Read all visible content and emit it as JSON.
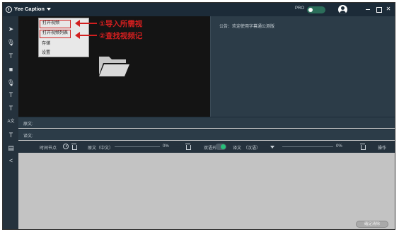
{
  "app": {
    "title": "Yee Caption"
  },
  "header": {
    "pro_label": "PRO"
  },
  "window_controls": {
    "close": "✕"
  },
  "toolbar_tools": [
    {
      "name": "pointer-icon",
      "glyph": "➤"
    },
    {
      "name": "microphone-icon",
      "glyph": "🎙"
    },
    {
      "name": "text-icon",
      "glyph": "T"
    },
    {
      "name": "rectangle-icon",
      "glyph": "■"
    },
    {
      "name": "mic-settings-icon",
      "glyph": "🎙"
    },
    {
      "name": "text-box-icon",
      "glyph": "T"
    },
    {
      "name": "text-style-icon",
      "glyph": "T"
    },
    {
      "name": "translate-icon",
      "glyph": "A文"
    },
    {
      "name": "subtitle-icon",
      "glyph": "T"
    },
    {
      "name": "film-icon",
      "glyph": "▤"
    },
    {
      "name": "share-icon",
      "glyph": "<"
    }
  ],
  "menu": {
    "items": [
      "打开视频",
      "打开视频列表",
      "存储",
      "设置"
    ]
  },
  "annotations": {
    "first": "①导入所需视",
    "second": "②查找视频记"
  },
  "notice": {
    "text": "公告：欢迎使用字幕通公测版"
  },
  "subtitles": {
    "original_label": "原文:",
    "translation_label": "译文:"
  },
  "controls": {
    "time_nodes_label": "时间节点",
    "original_lang_label": "原文（中文）",
    "original_progress": "0%",
    "bilingual_label": "双语开关",
    "translation_label": "译文",
    "translation_lang": "（汉语）",
    "translation_progress": "0%",
    "operation_label": "操作"
  },
  "bottom": {
    "button_label": "確定清除"
  },
  "colors": {
    "titlebar": "#1c2b38",
    "panel": "#2c3c48",
    "annotation_red": "#d21f1f",
    "toggle_green": "#27c07a"
  }
}
